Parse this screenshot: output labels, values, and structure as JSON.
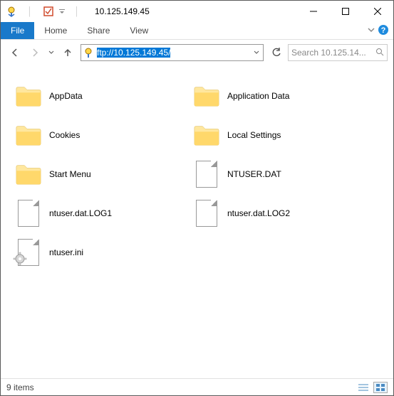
{
  "titlebar": {
    "title": "10.125.149.45"
  },
  "menu": {
    "file": "File",
    "home": "Home",
    "share": "Share",
    "view": "View"
  },
  "nav": {
    "address_full": "ftp://10.125.149.45/",
    "search_placeholder": "Search 10.125.14..."
  },
  "items": [
    {
      "type": "folder",
      "name": "AppData"
    },
    {
      "type": "folder",
      "name": "Application Data"
    },
    {
      "type": "folder",
      "name": "Cookies"
    },
    {
      "type": "folder",
      "name": "Local Settings"
    },
    {
      "type": "folder",
      "name": "Start Menu"
    },
    {
      "type": "file",
      "name": "NTUSER.DAT"
    },
    {
      "type": "file",
      "name": "ntuser.dat.LOG1"
    },
    {
      "type": "file",
      "name": "ntuser.dat.LOG2"
    },
    {
      "type": "ini",
      "name": "ntuser.ini"
    }
  ],
  "status": {
    "count": "9 items"
  }
}
